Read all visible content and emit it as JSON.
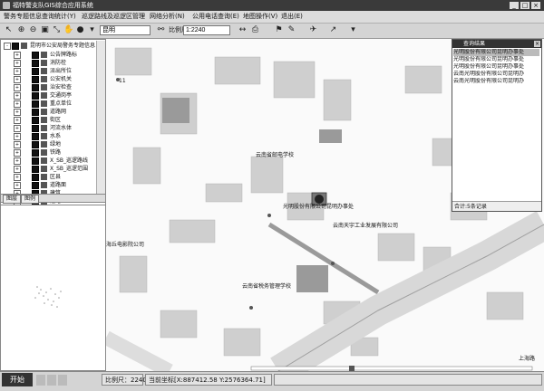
{
  "window": {
    "title": "福特警支队GIS综合应用系统",
    "min": "_",
    "max": "□",
    "close": "×"
  },
  "menu": [
    "警务专题信息查询统计(Y)",
    "巡逻路线及巡逻区管理",
    "网络分析(N)",
    "公用电话查询(E)",
    "地图操作(V)",
    "退出(E)"
  ],
  "toolbar": {
    "search_value": "昆明",
    "scale_label": "比例尺",
    "scale_value": "1:2240"
  },
  "layers": [
    {
      "label": "昆明市公安局警务专题信息"
    },
    {
      "label": "公告牌路标"
    },
    {
      "label": "消防栓"
    },
    {
      "label": "派出所位"
    },
    {
      "label": "公安机关"
    },
    {
      "label": "治安检查"
    },
    {
      "label": "交通岗亭"
    },
    {
      "label": "重点单位"
    },
    {
      "label": "道路网"
    },
    {
      "label": "街区"
    },
    {
      "label": "河流水体"
    },
    {
      "label": "水系"
    },
    {
      "label": "绿地"
    },
    {
      "label": "铁路"
    },
    {
      "label": "X_SB_巡逻路线"
    },
    {
      "label": "X_SB_巡逻范围"
    },
    {
      "label": "区县"
    },
    {
      "label": "道路面"
    },
    {
      "label": "建筑"
    },
    {
      "label": "道路"
    }
  ],
  "tabs": [
    "图层",
    "图例"
  ],
  "map_labels": {
    "l1": "云南省邮电学校",
    "l2": "光明股份有限公司昆明办事处",
    "l3": "云南天宇工业发展有限公司",
    "l4": "海丘电影院公司",
    "l5": "云南省税务管理学校",
    "l6": "上海路",
    "road_num": "11"
  },
  "results": {
    "title": "查询结果",
    "items": [
      "光明股份有限公司昆明办事处",
      "光明股份有限公司昆明办事处",
      "光明股份有限公司昆明办事处",
      "云南光明股份有限公司昆明办",
      "云南光明股份有限公司昆明办"
    ],
    "total": "合计:5条记录"
  },
  "status": {
    "start": "开始",
    "scale": "比例尺：2240",
    "coords": "当前坐标[X:887412.58 Y:2576364.71]"
  }
}
